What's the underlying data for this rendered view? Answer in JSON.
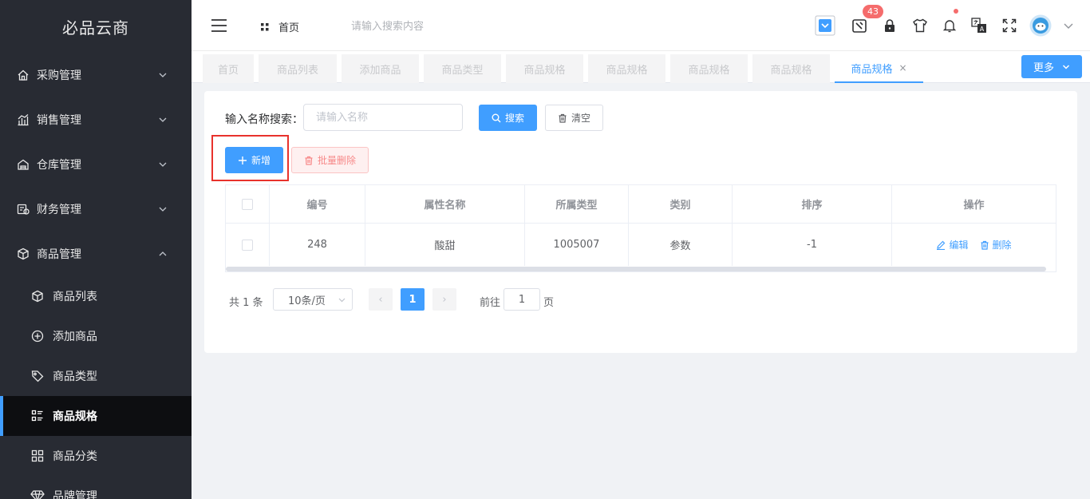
{
  "brand": "必品云商",
  "sidebar": {
    "menus": [
      {
        "label": "采购管理",
        "icon": "purchase-house-icon"
      },
      {
        "label": "销售管理",
        "icon": "sales-chart-icon"
      },
      {
        "label": "仓库管理",
        "icon": "warehouse-icon"
      },
      {
        "label": "财务管理",
        "icon": "finance-icon"
      },
      {
        "label": "商品管理",
        "icon": "goods-box-icon"
      }
    ],
    "goods_submenu": [
      {
        "label": "商品列表",
        "icon": "cube-icon"
      },
      {
        "label": "添加商品",
        "icon": "plus-circle-icon"
      },
      {
        "label": "商品类型",
        "icon": "tag-icon"
      },
      {
        "label": "商品规格",
        "icon": "spec-list-icon",
        "active": true
      },
      {
        "label": "商品分类",
        "icon": "grid-icon"
      },
      {
        "label": "品牌管理",
        "icon": "diamond-icon"
      }
    ]
  },
  "header": {
    "home_label": "首页",
    "search_placeholder": "请输入搜索内容",
    "notification_count": "43"
  },
  "tabs": {
    "items": [
      "首页",
      "商品列表",
      "添加商品",
      "商品类型",
      "商品规格",
      "商品规格",
      "商品规格",
      "商品规格",
      "商品规格"
    ],
    "active_index": 8,
    "close_glyph": "×",
    "more_label": "更多"
  },
  "filter": {
    "label": "输入名称搜索：",
    "input_placeholder": "请输入名称",
    "search_label": "搜索",
    "clear_label": "清空"
  },
  "actions": {
    "add_label": "新增",
    "batch_delete_label": "批量删除"
  },
  "table": {
    "columns": [
      "编号",
      "属性名称",
      "所属类型",
      "类别",
      "排序",
      "操作"
    ],
    "rows": [
      {
        "id": "248",
        "name": "酸甜",
        "type": "1005007",
        "category": "参数",
        "sort": "-1"
      }
    ],
    "edit_label": "编辑",
    "delete_label": "删除"
  },
  "pagination": {
    "total_text": "共 1 条",
    "page_size": "10条/页",
    "current_page": "1",
    "goto_label": "前往",
    "goto_value": "1",
    "page_suffix": "页",
    "prev_glyph": "‹",
    "next_glyph": "›"
  },
  "colors": {
    "primary": "#409eff",
    "sidebar_bg": "#282b33",
    "danger": "#f56c6c",
    "highlight_box": "#e8322c"
  }
}
